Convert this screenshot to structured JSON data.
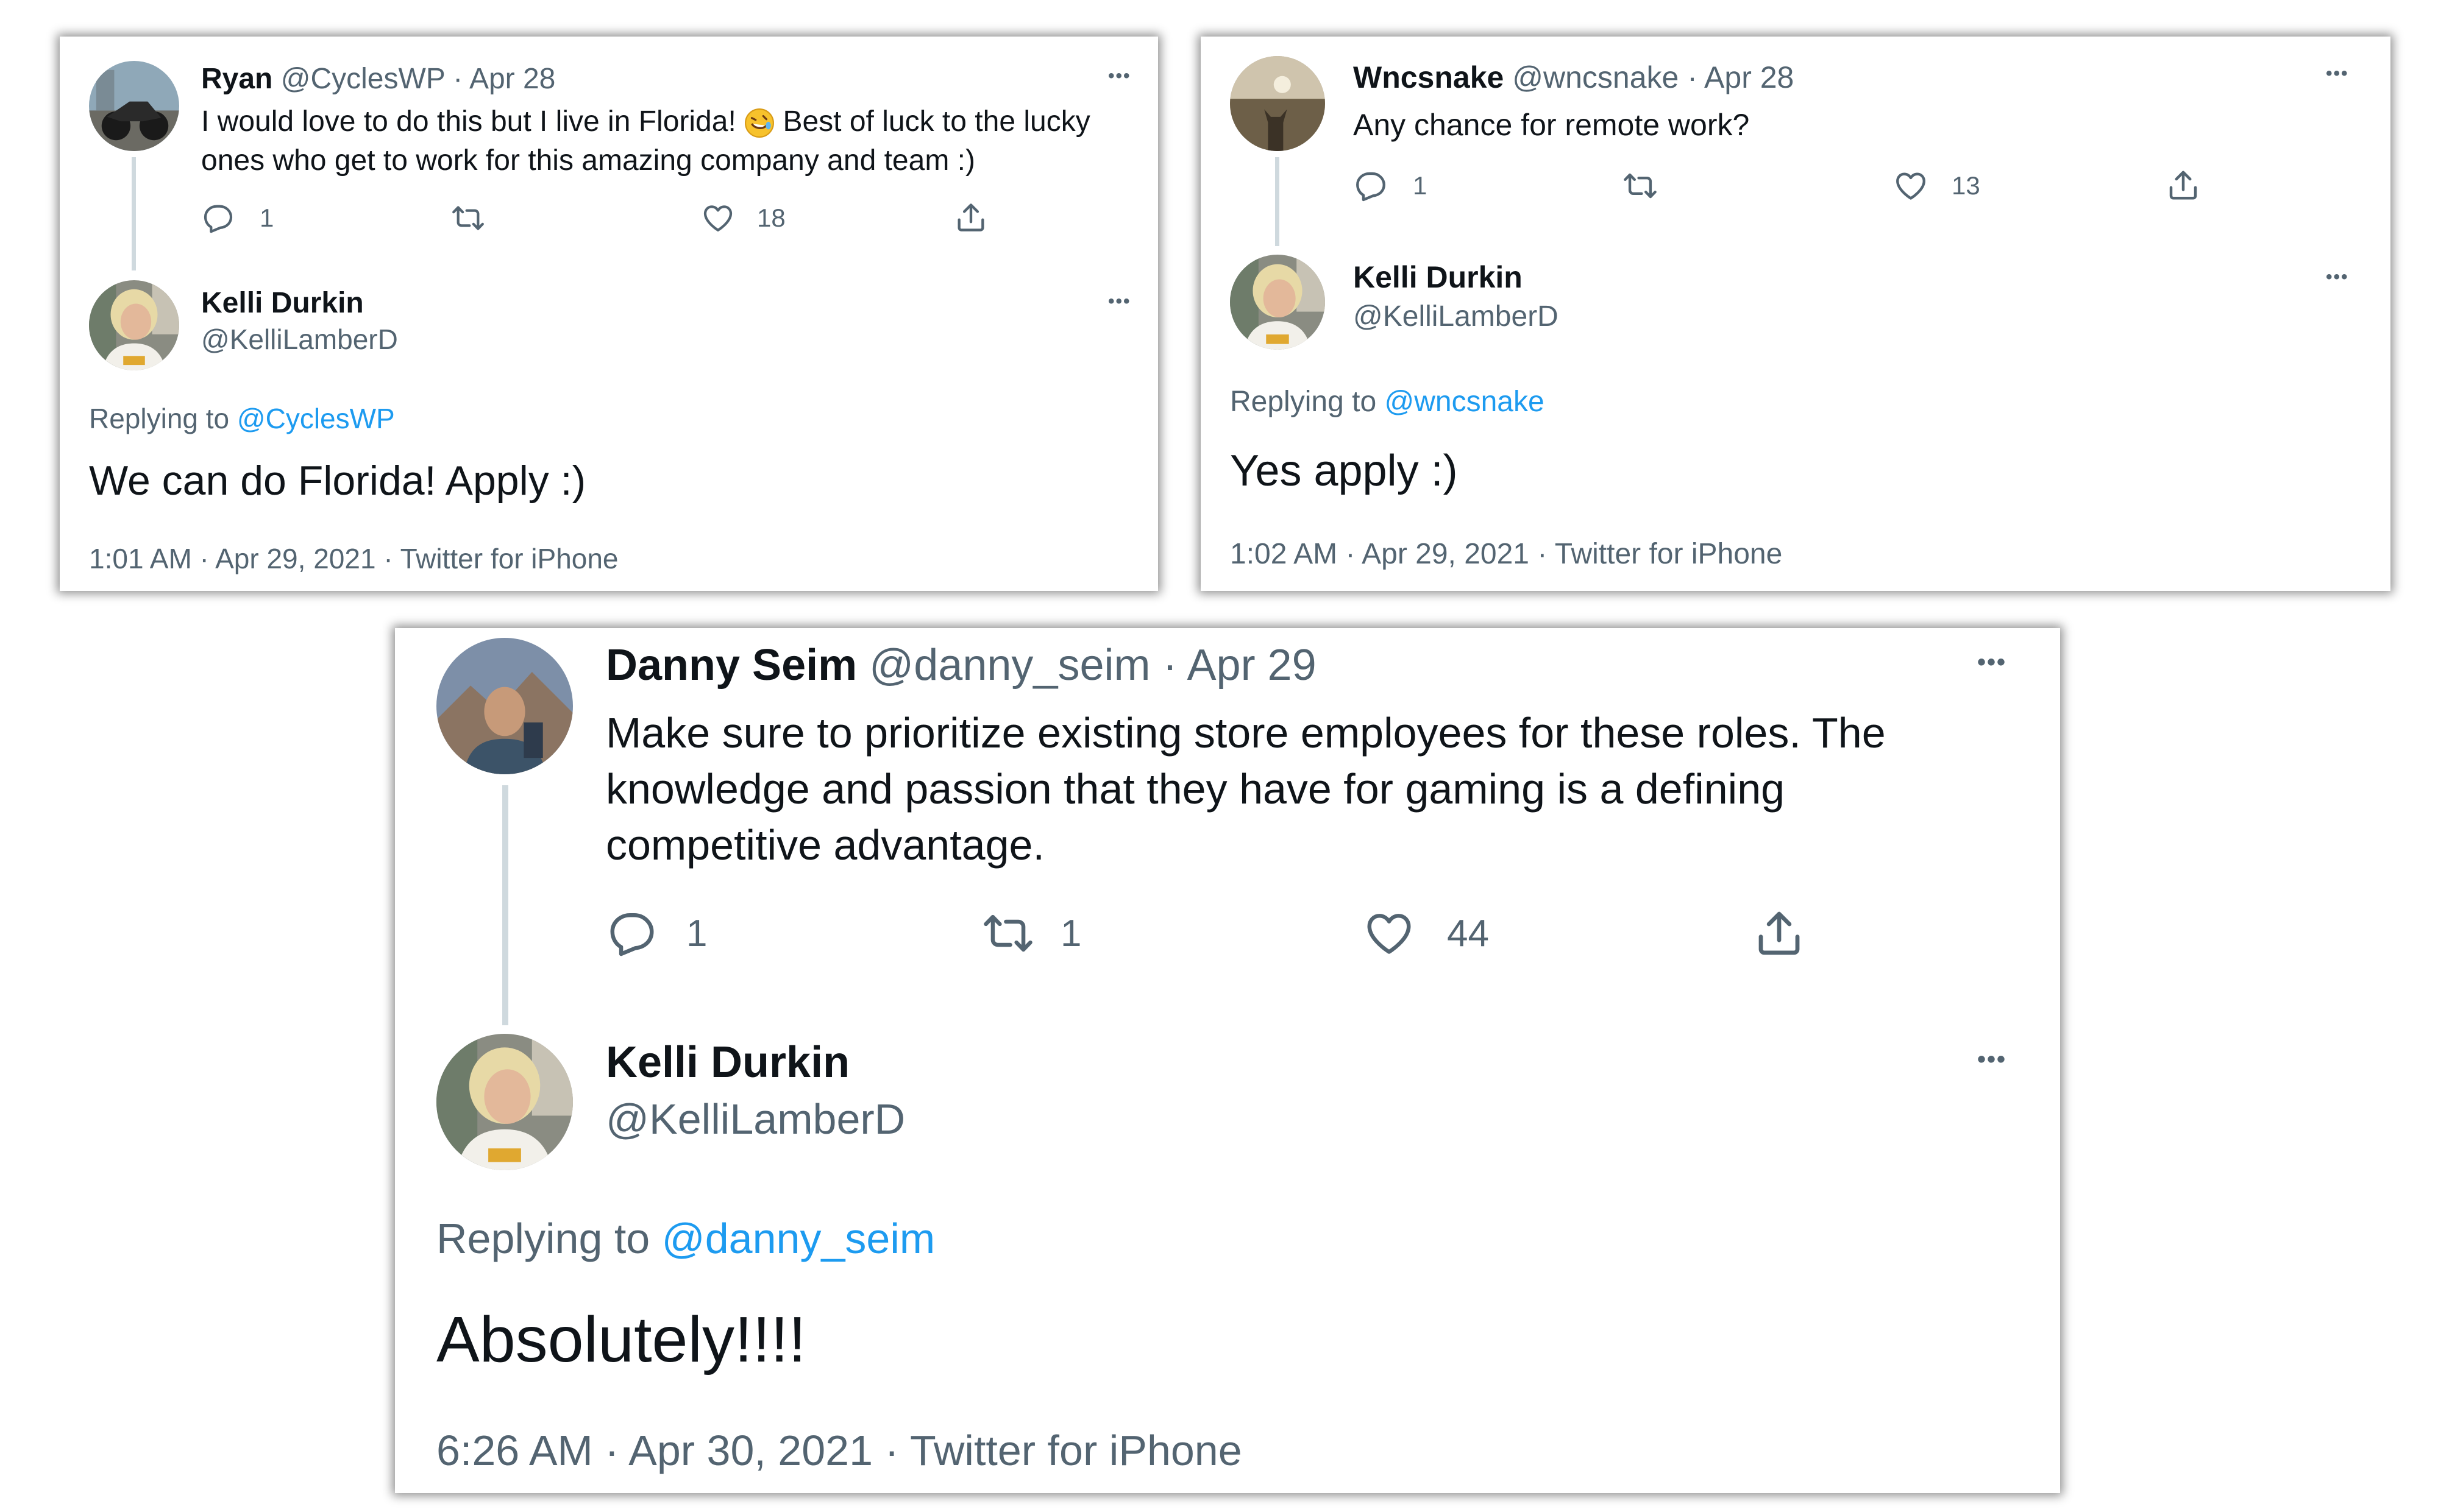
{
  "colors": {
    "link": "#1d9bf0",
    "muted": "#536471",
    "text": "#0f1419",
    "thread": "#cfd9de"
  },
  "tweet1": {
    "parent": {
      "name": "Ryan",
      "handle": "@CyclesWP",
      "date": "· Apr 28",
      "text_a": "I would love to do this but I live in Florida!",
      "emoji": "rolling-on-floor-laughing-emoji",
      "text_b": "Best of luck to the lucky",
      "text_c": "ones who get to work for this amazing company and team :)",
      "reply_count": "1",
      "retweet_count": "",
      "like_count": "18"
    },
    "reply": {
      "name": "Kelli Durkin",
      "handle": "@KelliLamberD",
      "replying_label": "Replying to",
      "replying_to": "@CyclesWP",
      "text": "We can do Florida! Apply :)",
      "meta": "1:01 AM · Apr 29, 2021 · Twitter for iPhone"
    }
  },
  "tweet2": {
    "parent": {
      "name": "Wncsnake",
      "handle": "@wncsnake",
      "date": "· Apr 28",
      "text": "Any chance for remote work?",
      "reply_count": "1",
      "retweet_count": "",
      "like_count": "13"
    },
    "reply": {
      "name": "Kelli Durkin",
      "handle": "@KelliLamberD",
      "replying_label": "Replying to",
      "replying_to": "@wncsnake",
      "text": "Yes apply :)",
      "meta": "1:02 AM · Apr 29, 2021 · Twitter for iPhone"
    }
  },
  "tweet3": {
    "parent": {
      "name": "Danny Seim",
      "handle": "@danny_seim",
      "date": "· Apr 29",
      "line1": "Make sure to prioritize existing store employees for these roles. The",
      "line2": "knowledge and passion that they have for gaming is a defining",
      "line3": "competitive advantage.",
      "reply_count": "1",
      "retweet_count": "1",
      "like_count": "44"
    },
    "reply": {
      "name": "Kelli Durkin",
      "handle": "@KelliLamberD",
      "replying_label": "Replying to",
      "replying_to": "@danny_seim",
      "text": "Absolutely!!!!",
      "meta": "6:26 AM · Apr 30, 2021 · Twitter for iPhone"
    }
  },
  "more_glyph": "•••"
}
